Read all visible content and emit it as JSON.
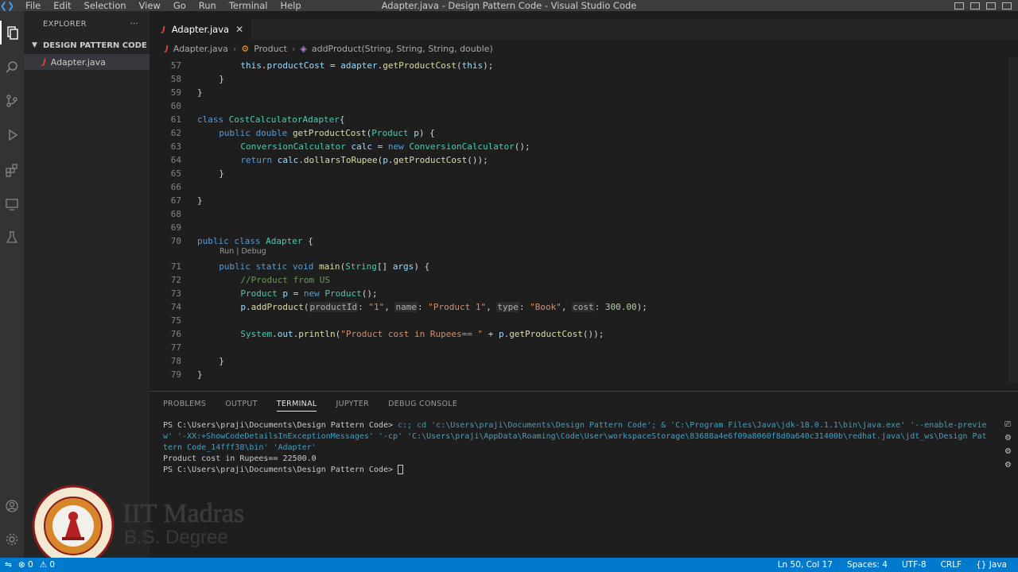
{
  "window": {
    "title": "Adapter.java - Design Pattern Code - Visual Studio Code",
    "menu": [
      "File",
      "Edit",
      "Selection",
      "View",
      "Go",
      "Run",
      "Terminal",
      "Help"
    ]
  },
  "sidebar": {
    "title": "EXPLORER",
    "more": "···",
    "folder": "DESIGN PATTERN CODE",
    "files": [
      {
        "label": "Adapter.java",
        "icon": "java-file-icon"
      }
    ]
  },
  "editor": {
    "tab": {
      "label": "Adapter.java",
      "close": "✕"
    },
    "breadcrumb": {
      "file": "Adapter.java",
      "class": "Product",
      "method": "addProduct(String, String, String, double)"
    },
    "codelens": "Run | Debug",
    "lines": [
      {
        "n": "57",
        "indent": 4,
        "text": "this.productCost = adapter.getProductCost(this);"
      },
      {
        "n": "58",
        "indent": 2,
        "text": "}"
      },
      {
        "n": "59",
        "indent": 0,
        "text": "}"
      },
      {
        "n": "60",
        "indent": 0,
        "text": ""
      },
      {
        "n": "61",
        "indent": 0,
        "text": "class CostCalculatorAdapter{"
      },
      {
        "n": "62",
        "indent": 2,
        "text": "public double getProductCost(Product p) {"
      },
      {
        "n": "63",
        "indent": 4,
        "text": "ConversionCalculator calc = new ConversionCalculator();"
      },
      {
        "n": "64",
        "indent": 4,
        "text": "return calc.dollarsToRupee(p.getProductCost());"
      },
      {
        "n": "65",
        "indent": 2,
        "text": "}"
      },
      {
        "n": "66",
        "indent": 0,
        "text": ""
      },
      {
        "n": "67",
        "indent": 0,
        "text": "}"
      },
      {
        "n": "68",
        "indent": 0,
        "text": ""
      },
      {
        "n": "69",
        "indent": 0,
        "text": ""
      },
      {
        "n": "70",
        "indent": 0,
        "text": "public class Adapter {"
      },
      {
        "n": "71",
        "indent": 2,
        "text": "public static void main(String[] args) {"
      },
      {
        "n": "72",
        "indent": 4,
        "text": "//Product from US"
      },
      {
        "n": "73",
        "indent": 4,
        "text": "Product p = new Product();"
      },
      {
        "n": "74",
        "indent": 4,
        "text": "p.addProduct(productId: \"1\", name: \"Product 1\", type: \"Book\", cost: 300.00);"
      },
      {
        "n": "75",
        "indent": 0,
        "text": ""
      },
      {
        "n": "76",
        "indent": 4,
        "text": "System.out.println(\"Product cost in Rupees== \" + p.getProductCost());"
      },
      {
        "n": "77",
        "indent": 0,
        "text": ""
      },
      {
        "n": "78",
        "indent": 2,
        "text": "}"
      },
      {
        "n": "79",
        "indent": 0,
        "text": "}"
      }
    ]
  },
  "panel": {
    "tabs": [
      "PROBLEMS",
      "OUTPUT",
      "TERMINAL",
      "JUPYTER",
      "DEBUG CONSOLE"
    ],
    "active_tab": "TERMINAL",
    "terminal": {
      "prompt1": "PS C:\\Users\\praji\\Documents\\Design Pattern Code> ",
      "cmd1": "c:; cd 'c:\\Users\\praji\\Documents\\Design Pattern Code'; & 'C:\\Program Files\\Java\\jdk-18.0.1.1\\bin\\java.exe' '--enable-preview' '-XX:+ShowCodeDetailsInExceptionMessages' '-cp' 'C:\\Users\\praji\\AppData\\Roaming\\Code\\User\\workspaceStorage\\83688a4e6f09a8060f8d0a640c31400b\\redhat.java\\jdt_ws\\Design Pattern Code_14fff38\\bin' 'Adapter'",
      "output": "Product cost in Rupees== 22500.0",
      "prompt2": "PS C:\\Users\\praji\\Documents\\Design Pattern Code> "
    }
  },
  "watermark": {
    "line1": "IIT Madras",
    "line2": "B.S. Degree"
  },
  "statusbar": {
    "errors": "⊗ 0",
    "warnings": "⚠ 0",
    "position": "Ln 50, Col 17",
    "spaces": "Spaces: 4",
    "encoding": "UTF-8",
    "eol": "CRLF",
    "language": "{} Java"
  },
  "colors": {
    "accent": "#007acc",
    "keyword": "#569cd6",
    "type": "#4ec9b0",
    "string": "#ce9178"
  }
}
